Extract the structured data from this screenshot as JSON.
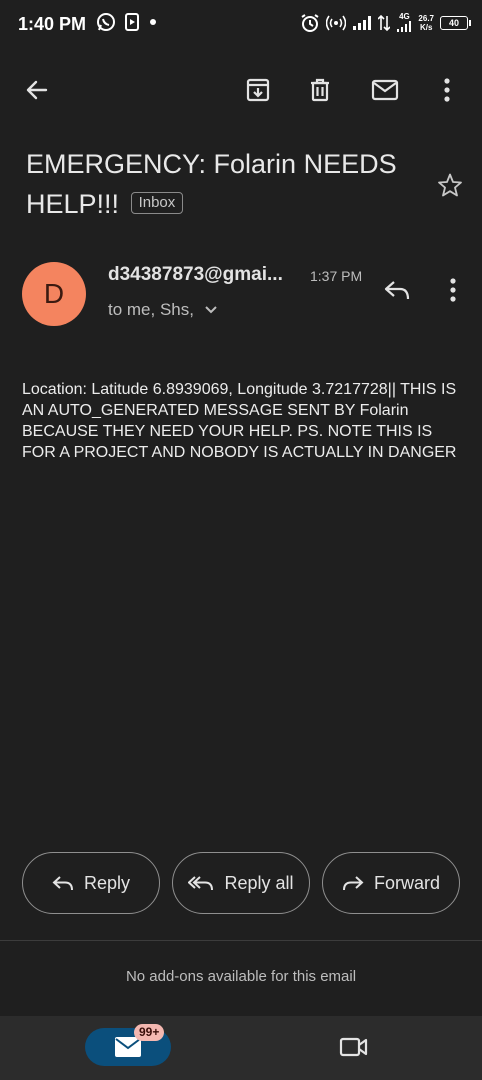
{
  "status_bar": {
    "time": "1:40 PM",
    "network_speed_value": "26.7",
    "network_speed_unit": "K/s",
    "network_type": "4G",
    "battery": "40"
  },
  "app_bar": {
    "icons": [
      "back-arrow-icon",
      "archive-icon",
      "delete-icon",
      "mark-unread-icon",
      "more-vert-icon"
    ]
  },
  "email": {
    "subject": "EMERGENCY: Folarin NEEDS HELP!!!",
    "label": "Inbox",
    "sender_initial": "D",
    "sender": "d34387873@gmai...",
    "time": "1:37 PM",
    "recipients": "to me, Shs,",
    "body": "Location: Latitude 6.8939069, Longitude 3.7217728|| THIS IS AN AUTO_GENERATED MESSAGE SENT BY Folarin BECAUSE THEY NEED YOUR HELP. PS. NOTE THIS IS FOR A PROJECT AND NOBODY IS ACTUALLY IN DANGER"
  },
  "actions": {
    "reply": "Reply",
    "reply_all": "Reply all",
    "forward": "Forward"
  },
  "addons_text": "No add-ons available for this email",
  "bottom_nav": {
    "mail_badge": "99+"
  },
  "colors": {
    "background": "#1f1f1f",
    "avatar": "#f4845f",
    "mail_tab_active": "#0b4f7c",
    "badge": "#f4b8b1"
  }
}
